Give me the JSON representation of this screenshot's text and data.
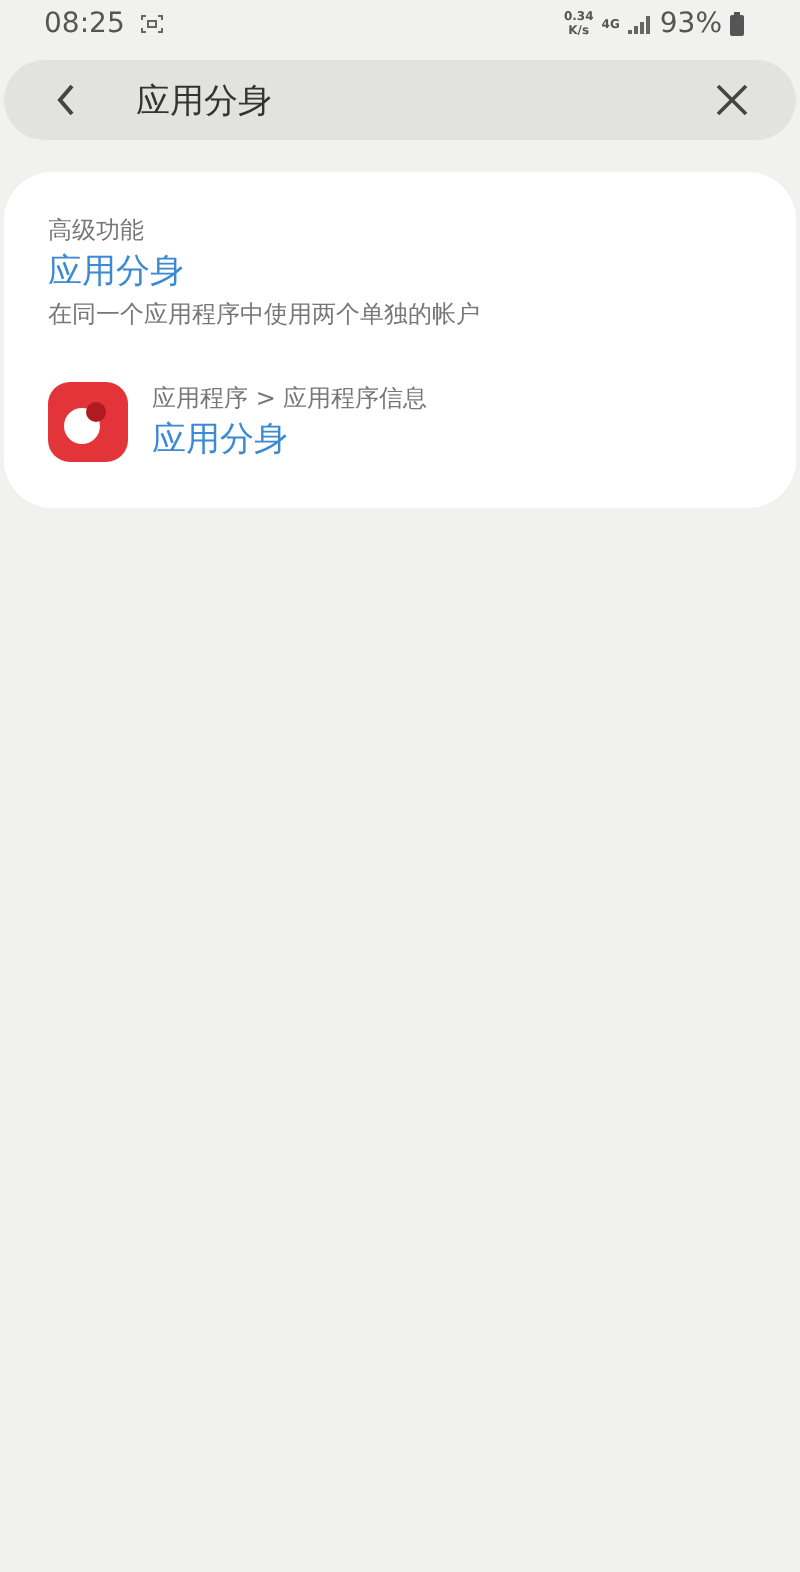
{
  "status_bar": {
    "time": "08:25",
    "speed_value": "0.34",
    "speed_unit": "K/s",
    "network": "4G",
    "battery": "93%"
  },
  "search": {
    "value": "应用分身"
  },
  "results": [
    {
      "kind": "setting",
      "category": "高级功能",
      "title": "应用分身",
      "description": "在同一个应用程序中使用两个单独的帐户"
    },
    {
      "kind": "app",
      "path": "应用程序 > 应用程序信息",
      "title": "应用分身"
    }
  ]
}
